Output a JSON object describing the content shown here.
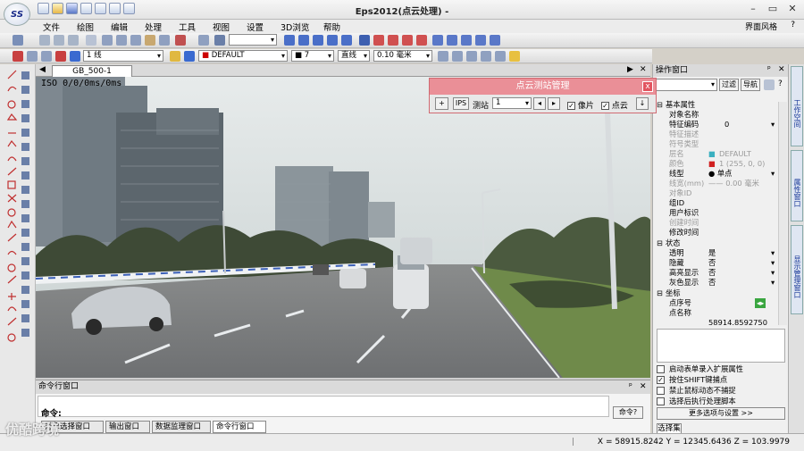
{
  "window": {
    "title": "Eps2012(点云处理) -",
    "logo": "SS"
  },
  "menu": [
    "文件",
    "绘图",
    "编辑",
    "处理",
    "工具",
    "视图",
    "设置",
    "3D浏览",
    "帮助"
  ],
  "theme_label": "界面风格",
  "toolbar2": {
    "line_weight": "1 线",
    "layer": "DEFAULT",
    "color_num": "7",
    "linetype": "直线",
    "width": "0.10 毫米"
  },
  "document": {
    "tab": "GB_500-1",
    "overlay": "ISO  0/0/0ms/0ms"
  },
  "cloud_panel": {
    "title": "点云测站管理",
    "ips": "IPS",
    "station_label": "测站",
    "station_value": "1",
    "photo_label": "像片",
    "cloud_label": "点云",
    "photo_checked": true,
    "cloud_checked": true
  },
  "right_panel": {
    "title": "操作窗口",
    "filter": "过滤",
    "nav": "导航",
    "sections": {
      "basic": "基本属性",
      "status": "状态",
      "coords": "坐标"
    },
    "rows": [
      {
        "k": "对象名称",
        "v": "",
        "grey": false
      },
      {
        "k": "特征编码",
        "v": "0",
        "grey": false
      },
      {
        "k": "特征描述",
        "v": "",
        "grey": true
      },
      {
        "k": "符号类型",
        "v": "",
        "grey": true
      },
      {
        "k": "层名",
        "v": "DEFAULT",
        "grey": true
      },
      {
        "k": "颜色",
        "v": "1 (255, 0, 0)",
        "grey": true
      },
      {
        "k": "线型",
        "v": "● 单点",
        "grey": false
      },
      {
        "k": "线宽(mm)",
        "v": "—— 0.00 毫米",
        "grey": true
      },
      {
        "k": "对象ID",
        "v": "",
        "grey": true
      },
      {
        "k": "组ID",
        "v": "",
        "grey": false
      },
      {
        "k": "用户标识",
        "v": "",
        "grey": false
      },
      {
        "k": "创建时间",
        "v": "",
        "grey": true
      },
      {
        "k": "修改时间",
        "v": "",
        "grey": false
      }
    ],
    "status_rows": [
      {
        "k": "透明",
        "v": "是"
      },
      {
        "k": "隐藏",
        "v": "否"
      },
      {
        "k": "高亮显示",
        "v": "否"
      },
      {
        "k": "灰色显示",
        "v": "否"
      }
    ],
    "coord_rows": [
      {
        "k": "点序号",
        "v": ""
      },
      {
        "k": "点名称",
        "v": ""
      },
      {
        "k": "",
        "v": "58914.8592750"
      }
    ],
    "options": [
      {
        "label": "启动表单录入扩展属性",
        "checked": false
      },
      {
        "label": "按住SHIFT键捕点",
        "checked": true
      },
      {
        "label": "禁止鼠标动态不捕捉",
        "checked": false
      },
      {
        "label": "选择后执行处理脚本",
        "checked": false
      }
    ],
    "more_btn": "更多选项与设置 >>",
    "select_tab": "选择集"
  },
  "side_tabs": [
    "工作空间",
    "属性窗口",
    "显示管理窗口"
  ],
  "command": {
    "title": "命令行窗口",
    "prompt": "命令:",
    "help": "命令?"
  },
  "bottom_tabs": [
    "对象选择窗口",
    "输出窗口",
    "数据监理窗口",
    "命令行窗口"
  ],
  "status": {
    "coords": "X = 58915.8242  Y = 12345.6436  Z = 103.9979"
  },
  "watermark": "优酷跨境"
}
